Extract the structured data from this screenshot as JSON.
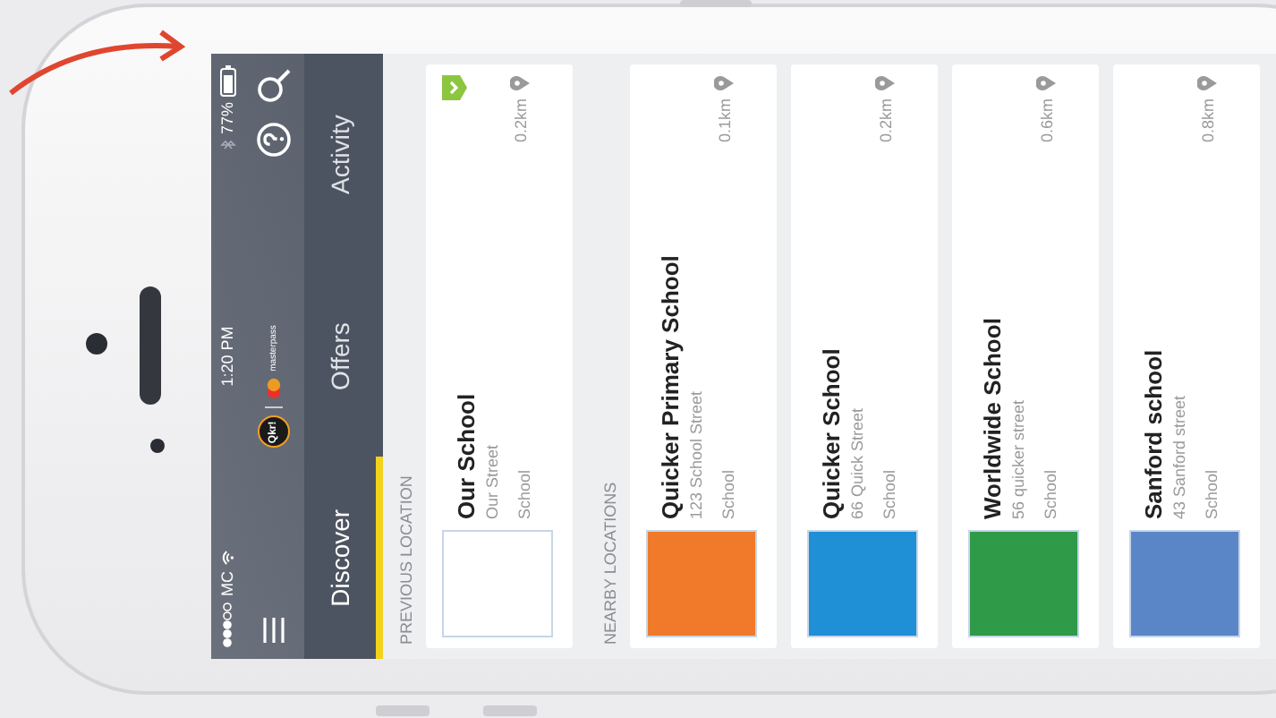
{
  "status_bar": {
    "carrier": "MC",
    "time": "1:20 PM",
    "battery": "77%"
  },
  "header": {
    "logo_text": "Qkr!",
    "partner": "masterpass"
  },
  "tabs": [
    {
      "label": "Discover",
      "selected": true
    },
    {
      "label": "Offers",
      "selected": false
    },
    {
      "label": "Activity",
      "selected": false
    }
  ],
  "sections": [
    {
      "title": "PREVIOUS LOCATION",
      "locations": [
        {
          "name": "Our School",
          "street": "Our Street",
          "type": "School",
          "distance": "0.2km",
          "verified": true,
          "color": "#ffffff"
        }
      ]
    },
    {
      "title": "NEARBY LOCATIONS",
      "locations": [
        {
          "name": "Quicker Primary School",
          "street": "123 School Street",
          "type": "School",
          "distance": "0.1km",
          "verified": false,
          "color": "#f07a2a"
        },
        {
          "name": "Quicker School",
          "street": "66 Quick Street",
          "type": "School",
          "distance": "0.2km",
          "verified": false,
          "color": "#1f8fd6"
        },
        {
          "name": "Worldwide School",
          "street": "56 quicker street",
          "type": "School",
          "distance": "0.6km",
          "verified": false,
          "color": "#2f9a48"
        },
        {
          "name": "Sanford school",
          "street": "43 Sanford street",
          "type": "School",
          "distance": "0.8km",
          "verified": false,
          "color": "#5a86c8"
        }
      ]
    }
  ]
}
